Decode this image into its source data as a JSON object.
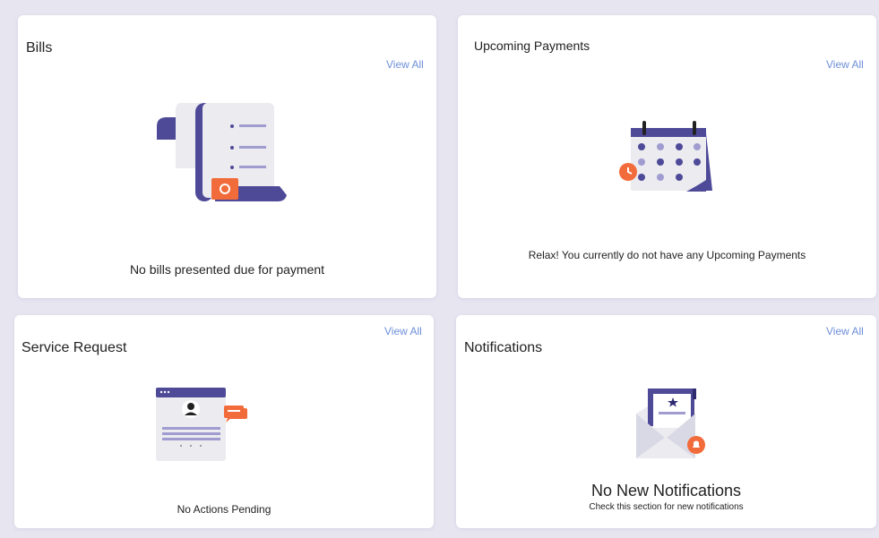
{
  "bills": {
    "title": "Bills",
    "view_all": "View All",
    "message": "No bills presented due for payment"
  },
  "upcoming_payments": {
    "title": "Upcoming Payments",
    "view_all": "View All",
    "message": "Relax! You currently do not have any Upcoming Payments"
  },
  "service_request": {
    "title": "Service Request",
    "view_all": "View All",
    "message": "No Actions Pending"
  },
  "notifications": {
    "title": "Notifications",
    "view_all": "View All",
    "message": "No New Notifications",
    "sub_message": "Check this section for new notifications"
  },
  "icons": {
    "bills": "bill-scroll-icon",
    "upcoming_payments": "calendar-clock-icon",
    "service_request": "profile-chat-icon",
    "notifications": "envelope-bell-icon"
  },
  "colors": {
    "background": "#e7e5f0",
    "card": "#ffffff",
    "link": "#6e8fd8",
    "accent_purple": "#4e4a98",
    "accent_orange": "#f26b3a",
    "light_grey": "#ebebf0"
  }
}
